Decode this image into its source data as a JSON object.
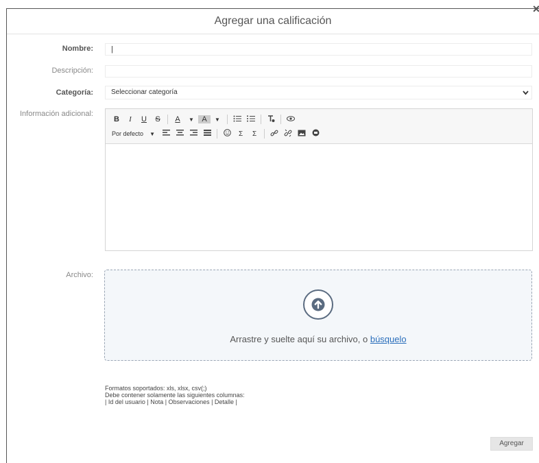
{
  "dialog": {
    "title": "Agregar una calificación",
    "close_glyph": "×"
  },
  "form": {
    "nombre_label": "Nombre:",
    "nombre_value": "|",
    "descripcion_label": "Descripción:",
    "descripcion_value": "",
    "categoria_label": "Categoría:",
    "categoria_selected": "Seleccionar categoría",
    "info_label": "Información adicional:",
    "archivo_label": "Archivo:"
  },
  "toolbar": {
    "bold": "B",
    "italic": "I",
    "underline": "U",
    "strikethrough": "S",
    "font_color": "A",
    "bg_color": "A",
    "format_default": "Por defecto",
    "subscript": "Σ",
    "superscript": "Σ"
  },
  "dropzone": {
    "text": "Arrastre y suelte aquí su archivo, o ",
    "link": "búsquelo"
  },
  "formats": {
    "line1": "Formatos soportados: xls, xlsx, csv(;)",
    "line2": "Debe contener solamente las siguientes columnas:",
    "line3": "| Id del usuario | Nota | Observaciones | Detalle |"
  },
  "actions": {
    "add_label": "Agregar"
  },
  "colors": {
    "accent_link": "#2a6ebb",
    "upload_icon": "#5a6b80",
    "dropzone_bg": "#f4f7fa"
  }
}
